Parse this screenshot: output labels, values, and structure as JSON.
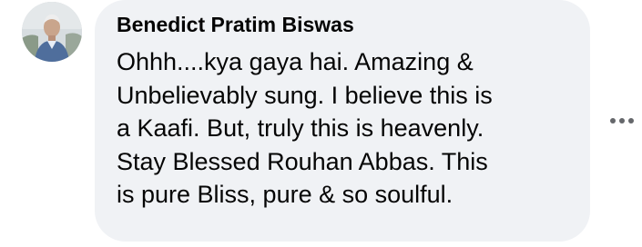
{
  "comment": {
    "author": "Benedict Pratim Biswas",
    "lines": [
      "Ohhh....kya gaya hai. Amazing &",
      "Unbelievably sung. I believe this is",
      "a Kaafi. But, truly this is heavenly.",
      "Stay Blessed Rouhan Abbas. This",
      "is pure Bliss, pure & so soulful."
    ]
  },
  "icons": {
    "avatar": "profile-photo",
    "more": "more-options-ellipsis-icon"
  },
  "colors": {
    "bubble_bg": "#f0f2f5",
    "text": "#050505",
    "icon": "#65676b"
  }
}
